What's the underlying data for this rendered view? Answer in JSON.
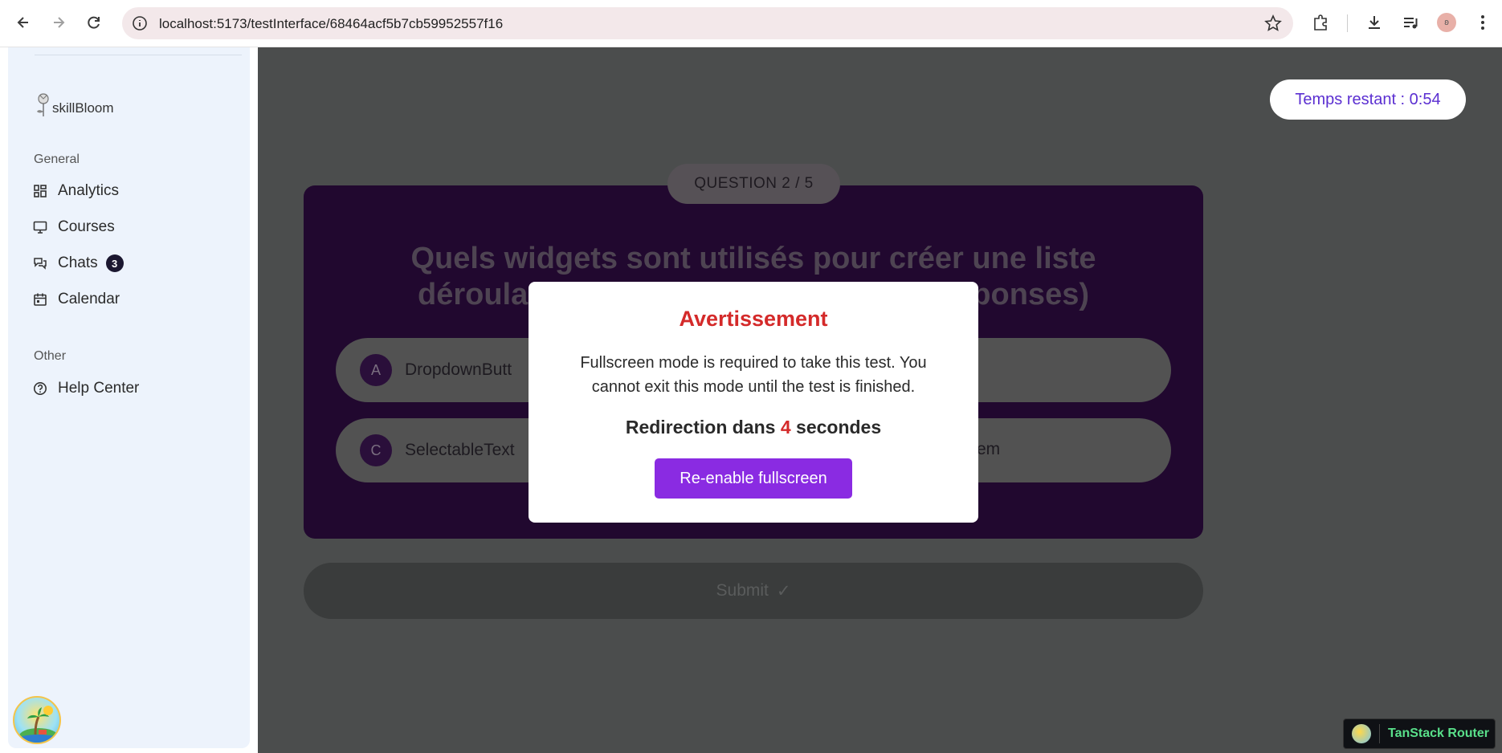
{
  "browser": {
    "url": "localhost:5173/testInterface/68464acf5b7cb59952557f16",
    "profile_initial": "ʚ"
  },
  "sidebar": {
    "logo_text": "skillBloom",
    "general_label": "General",
    "items": [
      {
        "label": "Analytics",
        "icon": "grid-icon"
      },
      {
        "label": "Courses",
        "icon": "monitor-icon"
      },
      {
        "label": "Chats",
        "icon": "chat-icon",
        "badge": "3"
      },
      {
        "label": "Calendar",
        "icon": "calendar-icon"
      }
    ],
    "other_label": "Other",
    "other_items": [
      {
        "label": "Help Center",
        "icon": "help-icon"
      }
    ]
  },
  "timer": {
    "text": "Temps restant : 0:54"
  },
  "question": {
    "counter": "QUESTION 2 / 5",
    "title_line1": "Quels widgets sont utilisés pour créer une liste",
    "title_line2_left": "déroula",
    "title_line2_right": "ponses)",
    "answers": [
      {
        "letter": "A",
        "text": "DropdownButt"
      },
      {
        "letter": "C",
        "text": "SelectableText",
        "right_text": "em"
      }
    ]
  },
  "submit": {
    "label": "Submit",
    "check": "✓"
  },
  "modal": {
    "title": "Avertissement",
    "message_line1": "Fullscreen mode is required to take this test. You",
    "message_line2": "cannot exit this mode until the test is finished.",
    "redirect_prefix": "Redirection dans",
    "redirect_count": "4",
    "redirect_suffix": "secondes",
    "button_label": "Re-enable fullscreen"
  },
  "devtools": {
    "label": "TanStack Router"
  },
  "colors": {
    "accent": "#8a2be2",
    "warning": "#d42a2a",
    "timer_text": "#5b2fd1"
  }
}
